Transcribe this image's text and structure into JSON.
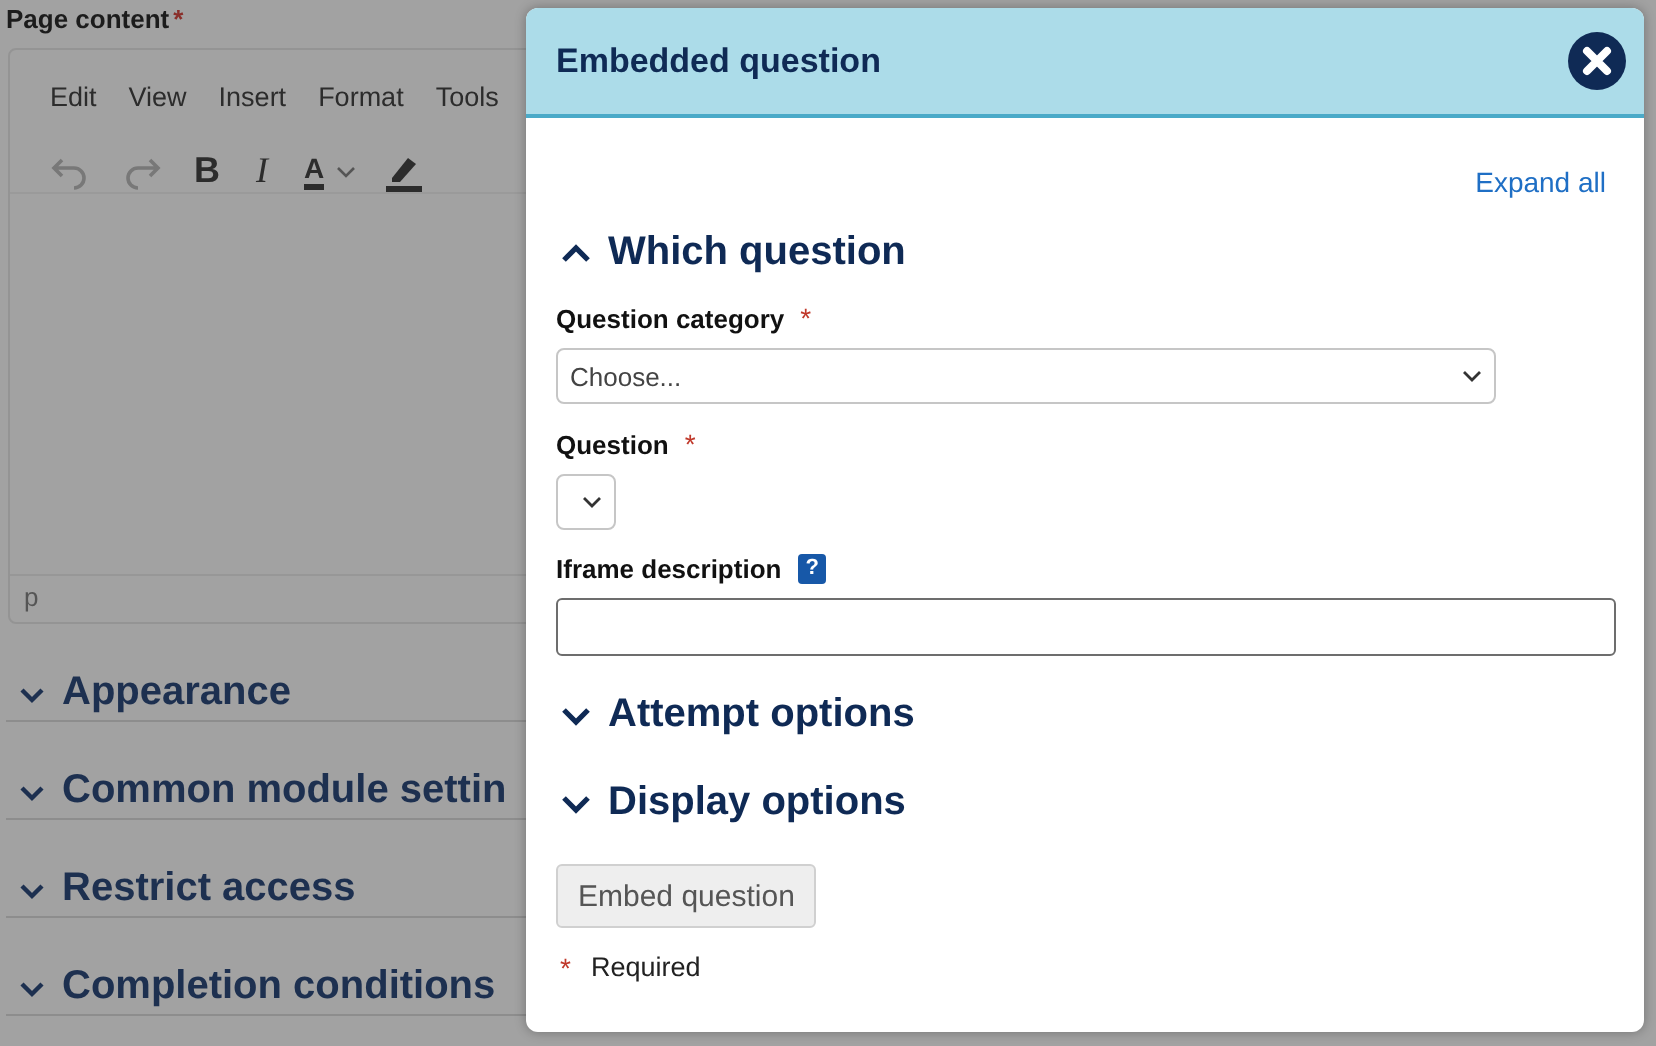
{
  "page": {
    "title": "Page content",
    "required_mark": "*",
    "editor": {
      "menu": [
        "Edit",
        "View",
        "Insert",
        "Format",
        "Tools"
      ],
      "toolbar": [
        {
          "kind": "undo",
          "disabled": true
        },
        {
          "kind": "redo",
          "disabled": true
        },
        {
          "kind": "bold",
          "label": "B",
          "disabled": false
        },
        {
          "kind": "italic",
          "label": "I",
          "disabled": false
        },
        {
          "kind": "text-color",
          "label": "A",
          "disabled": false
        },
        {
          "kind": "highlight",
          "disabled": false
        }
      ],
      "status_path": "p"
    },
    "sections": [
      {
        "title": "Appearance",
        "expanded": false
      },
      {
        "title": "Common module settin",
        "expanded": false
      },
      {
        "title": "Restrict access",
        "expanded": false
      },
      {
        "title": "Completion conditions",
        "expanded": false
      }
    ]
  },
  "modal": {
    "title": "Embedded question",
    "expand_all": "Expand all",
    "sections": [
      {
        "title": "Which question",
        "expanded": true,
        "fields": [
          {
            "kind": "select",
            "label": "Question category",
            "required": true,
            "placeholder": "Choose...",
            "wide": true
          },
          {
            "kind": "select",
            "label": "Question",
            "required": true,
            "wide": false
          },
          {
            "kind": "text",
            "label": "Iframe description",
            "help": "?"
          }
        ]
      },
      {
        "title": "Attempt options",
        "expanded": false
      },
      {
        "title": "Display options",
        "expanded": false
      }
    ],
    "button": {
      "label": "Embed question",
      "disabled": true
    },
    "required_note": {
      "mark": "*",
      "text": "Required"
    }
  }
}
